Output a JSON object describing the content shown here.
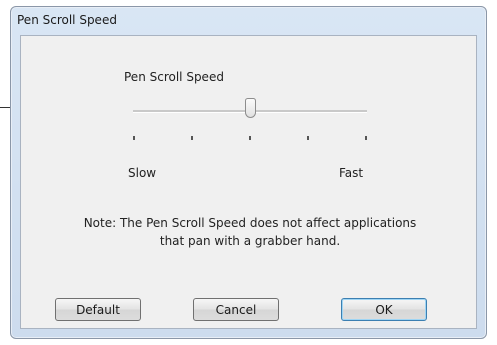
{
  "window": {
    "title": "Pen Scroll Speed"
  },
  "slider": {
    "label": "Pen Scroll Speed",
    "value_position": 0.5,
    "tick_count": 5,
    "min_label": "Slow",
    "max_label": "Fast"
  },
  "note": {
    "line1": "Note: The Pen Scroll Speed does not affect applications",
    "line2": "that pan with a grabber hand."
  },
  "buttons": {
    "default_label": "Default",
    "cancel_label": "Cancel",
    "ok_label": "OK"
  }
}
